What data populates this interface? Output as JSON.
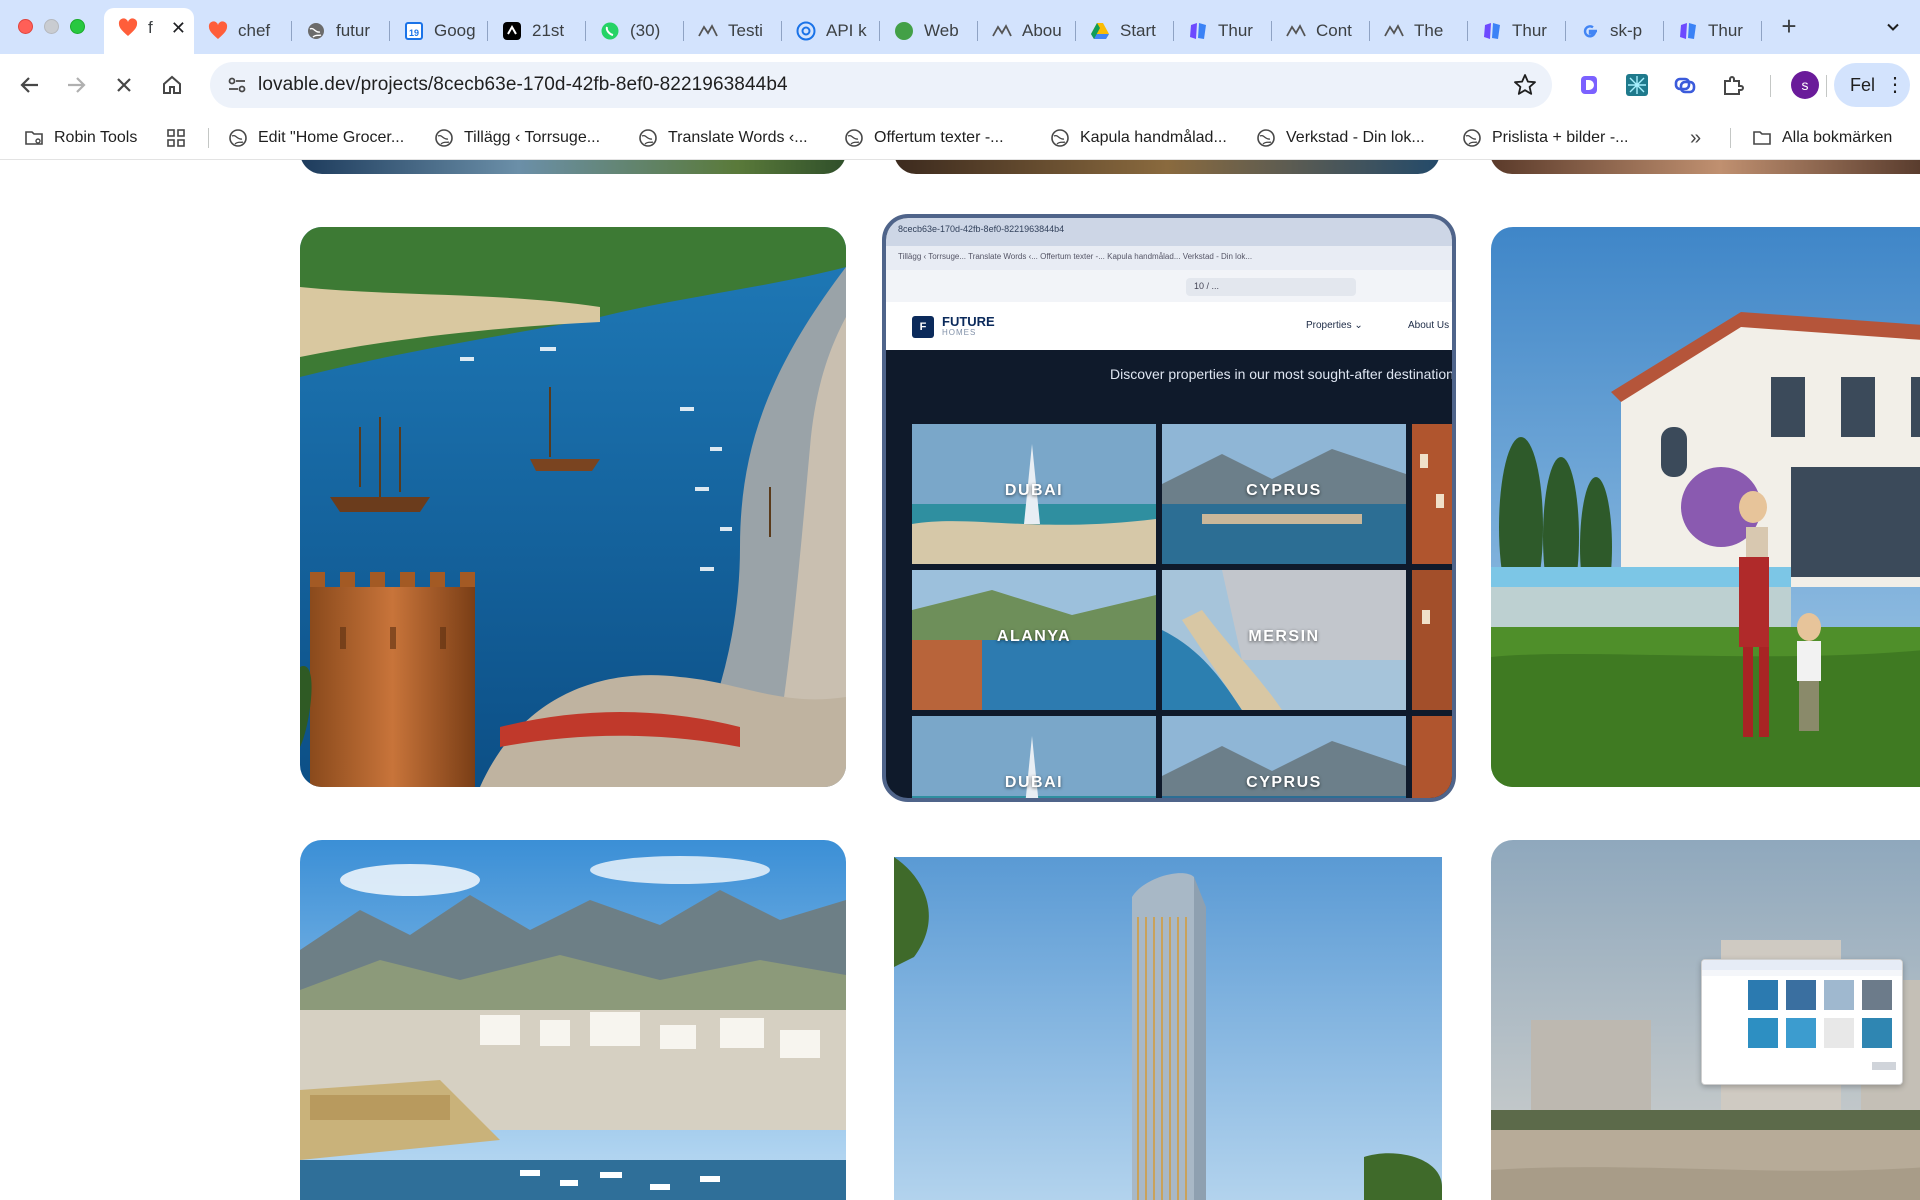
{
  "browser": {
    "tabs": [
      {
        "title": "f",
        "icon": "lovable-heart-icon",
        "active": true,
        "color": "#ff5e3a"
      },
      {
        "title": "chef",
        "icon": "lovable-heart-icon",
        "color": "#ff5e3a"
      },
      {
        "title": "futur",
        "icon": "globe-icon",
        "color": "#6b6b6b"
      },
      {
        "title": "Goog",
        "icon": "google-calendar-icon",
        "color": "#1a73e8"
      },
      {
        "title": "21st",
        "icon": "21st-icon",
        "color": "#000000"
      },
      {
        "title": "(30)",
        "icon": "whatsapp-icon",
        "color": "#25d366"
      },
      {
        "title": "Testi",
        "icon": "wave-icon",
        "color": "#555555"
      },
      {
        "title": "API k",
        "icon": "openai-icon",
        "color": "#1a73e8"
      },
      {
        "title": "Web",
        "icon": "green-dot-icon",
        "color": "#43a047"
      },
      {
        "title": "Abou",
        "icon": "wave-icon",
        "color": "#555555"
      },
      {
        "title": "Start",
        "icon": "google-drive-icon",
        "color": "#fbbc04"
      },
      {
        "title": "Thur",
        "icon": "make-icon",
        "color": "#6d4aff"
      },
      {
        "title": "Cont",
        "icon": "wave-icon",
        "color": "#555555"
      },
      {
        "title": "The",
        "icon": "wave-icon",
        "color": "#555555"
      },
      {
        "title": "Thur",
        "icon": "make-icon",
        "color": "#6d4aff"
      },
      {
        "title": "sk-p",
        "icon": "google-icon",
        "color": "#4285f4"
      },
      {
        "title": "Thur",
        "icon": "make-icon",
        "color": "#6d4aff"
      }
    ],
    "close_tab_glyph": "✕",
    "new_tab_glyph": "+",
    "address": "lovable.dev/projects/8cecb63e-170d-42fb-8ef0-8221963844b4",
    "profile_initial": "s",
    "profile_label": "Fel",
    "menu_glyph": "⋮"
  },
  "bookmarks": [
    {
      "label": "Robin Tools",
      "icon": "folder-gear-icon"
    },
    {
      "label": "",
      "icon": "apps-grid-icon"
    },
    {
      "label": "Edit \"Home Grocer...",
      "icon": "globe-icon"
    },
    {
      "label": "Tillägg ‹ Torrsuge...",
      "icon": "globe-icon"
    },
    {
      "label": "Translate Words ‹...",
      "icon": "globe-icon"
    },
    {
      "label": "Offertum texter -...",
      "icon": "globe-icon"
    },
    {
      "label": "Kapula handmålad...",
      "icon": "globe-icon"
    },
    {
      "label": "Verkstad - Din lok...",
      "icon": "globe-icon"
    },
    {
      "label": "Prislista + bilder -...",
      "icon": "globe-icon"
    }
  ],
  "bookmarks_overflow": "»",
  "all_bookmarks": "Alla bokmärken",
  "inner_screenshot": {
    "url_fragment": "8cecb63e-170d-42fb-8ef0-8221963844b4",
    "bookmarks_line": "Tillägg ‹ Torrsuge...   Translate Words ‹...   Offertum texter -...   Kapula handmålad...   Verkstad - Din lok...",
    "address_fragment": "10 / ...",
    "logo_letter": "F",
    "brand": "FUTURE",
    "brand_sub": "HOMES",
    "nav_properties": "Properties ⌄",
    "nav_about": "About Us",
    "subtitle": "Discover properties in our most sought-after destinations",
    "cities": [
      "DUBAI",
      "CYPRUS",
      "ALANYA",
      "MERSIN",
      "DUBAI",
      "CYPRUS"
    ]
  }
}
